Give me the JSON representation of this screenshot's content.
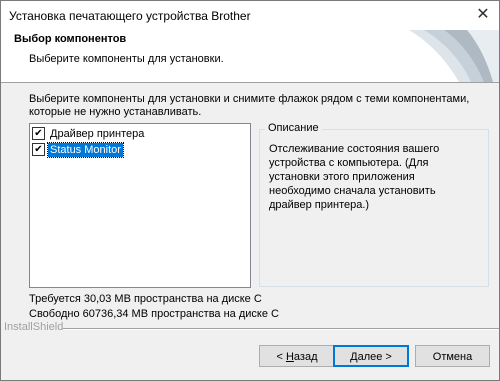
{
  "window": {
    "title": "Установка печатающего устройства Brother",
    "close_glyph": "✕"
  },
  "header": {
    "title": "Выбор компонентов",
    "subtitle": "Выберите компоненты для установки."
  },
  "instructions": "Выберите компоненты для установки и снимите флажок рядом с теми компонентами, которые не нужно устанавливать.",
  "components": [
    {
      "label": "Драйвер принтера",
      "checked": true,
      "selected": false
    },
    {
      "label": "Status Monitor",
      "checked": true,
      "selected": true
    }
  ],
  "description": {
    "legend": "Описание",
    "text": "Отслеживание состояния вашего устройства с компьютера. (Для установки этого приложения необходимо сначала установить драйвер принтера.)"
  },
  "space_required": "Требуется 30,03 MB пространства на диске C",
  "space_free": "Свободно 60736,34 MB пространства на диске C",
  "brand_label": "InstallShield",
  "buttons": {
    "back_prefix": "< ",
    "back_accel": "Н",
    "back_rest": "азад",
    "next_accel": "Д",
    "next_rest": "алее >",
    "cancel": "Отмена"
  },
  "colors": {
    "selection": "#0078d7",
    "default_border": "#0078d7"
  }
}
